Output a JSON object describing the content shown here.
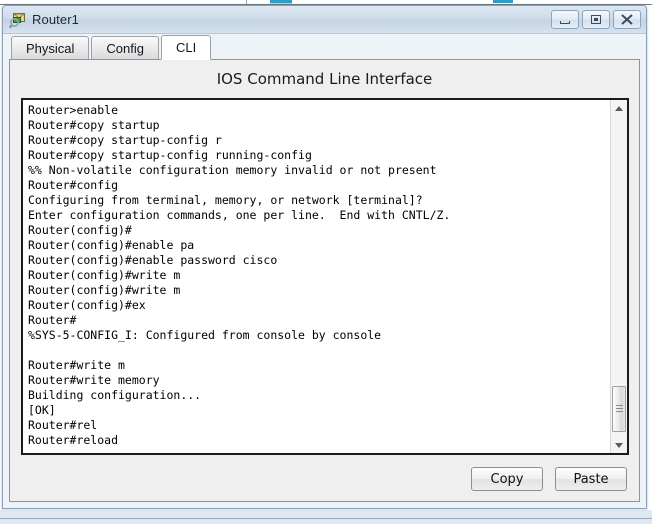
{
  "window": {
    "title": "Router1",
    "icon": "router-device-icon",
    "controls": {
      "minimize": "minimize-button",
      "maximize": "maximize-button",
      "close": "close-button"
    }
  },
  "tabs": [
    {
      "label": "Physical",
      "active": false
    },
    {
      "label": "Config",
      "active": false
    },
    {
      "label": "CLI",
      "active": true
    }
  ],
  "panel": {
    "heading": "IOS Command Line Interface"
  },
  "terminal": {
    "lines": [
      "Router>enable",
      "Router#copy startup",
      "Router#copy startup-config r",
      "Router#copy startup-config running-config",
      "%% Non-volatile configuration memory invalid or not present",
      "Router#config",
      "Configuring from terminal, memory, or network [terminal]?",
      "Enter configuration commands, one per line.  End with CNTL/Z.",
      "Router(config)#",
      "Router(config)#enable pa",
      "Router(config)#enable password cisco",
      "Router(config)#write m",
      "Router(config)#write m",
      "Router(config)#ex",
      "Router#",
      "%SYS-5-CONFIG_I: Configured from console by console",
      "",
      "Router#write m",
      "Router#write memory",
      "Building configuration...",
      "[OK]",
      "Router#rel",
      "Router#reload"
    ]
  },
  "scrollbar": {
    "up_arrow": "scroll-up-arrow",
    "down_arrow": "scroll-down-arrow",
    "thumb": "scroll-thumb"
  },
  "actions": {
    "copy_label": "Copy",
    "paste_label": "Paste"
  },
  "colors": {
    "title_bar": "#cfdcea",
    "panel_bg": "#efefef",
    "terminal_bg": "#ffffff",
    "terminal_text": "#000000",
    "desktop": "#c3d2e3",
    "accent_teal": "#2f9dc4"
  }
}
